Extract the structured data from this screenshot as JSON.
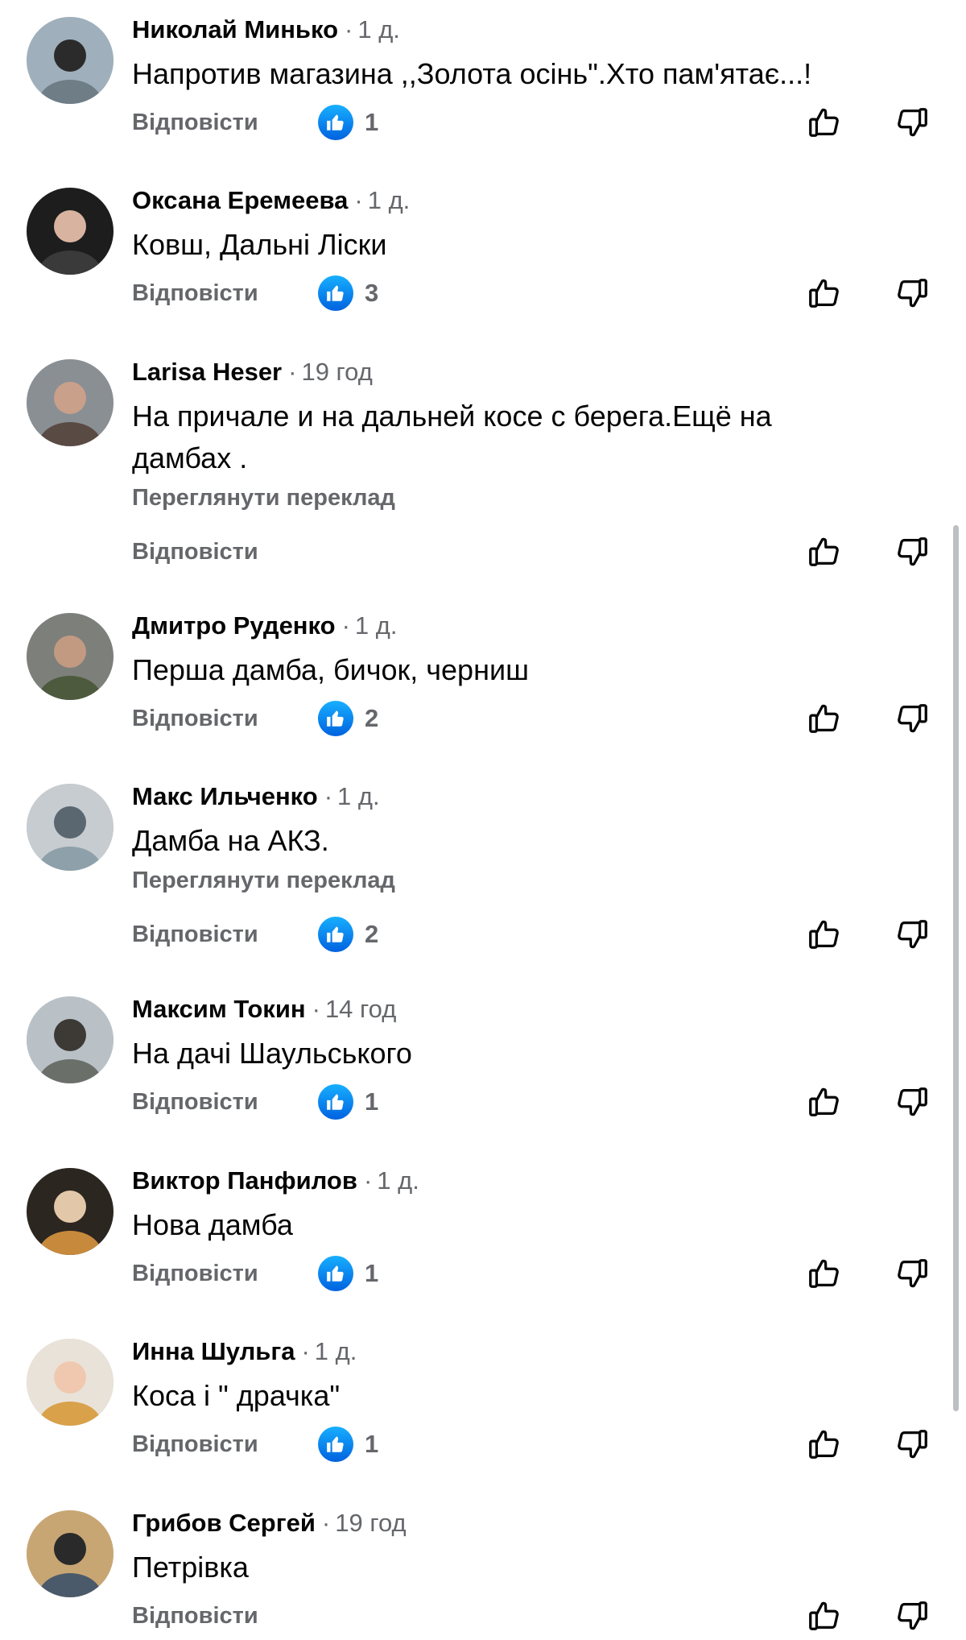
{
  "labels": {
    "reply": "Відповісти",
    "translate": "Переглянути переклад"
  },
  "icons": {
    "like": "like-icon",
    "upvote": "thumbs-up-outline-icon",
    "downvote": "thumbs-down-outline-icon"
  },
  "colors": {
    "like_blue": "#0866ff",
    "muted": "#65676b",
    "text": "#050505"
  },
  "comments": [
    {
      "author": "Николай Минько",
      "time": "1 д.",
      "text": "Напротив магазина ,,Золота осінь\".Хто пам'ятає...!",
      "likes": "1",
      "translate": false
    },
    {
      "author": "Оксана Еремеева",
      "time": "1 д.",
      "text": "Ковш, Дальні Ліски",
      "likes": "3",
      "translate": false
    },
    {
      "author": "Larisa Heser",
      "time": "19 год",
      "text": "На причале и на дальней косе с берега.Ещё на дамбах .",
      "likes": null,
      "translate": true
    },
    {
      "author": "Дмитро Руденко",
      "time": "1 д.",
      "text": "Перша дамба, бичок, черниш",
      "likes": "2",
      "translate": false
    },
    {
      "author": "Макс Ильченко",
      "time": "1 д.",
      "text": "Дамба на АКЗ.",
      "likes": "2",
      "translate": true
    },
    {
      "author": "Максим Токин",
      "time": "14 год",
      "text": "На дачі Шаульського",
      "likes": "1",
      "translate": false
    },
    {
      "author": "Виктор Панфилов",
      "time": "1 д.",
      "text": "Нова дамба",
      "likes": "1",
      "translate": false
    },
    {
      "author": "Инна Шульга",
      "time": "1 д.",
      "text": "Коса і \" драчка\"",
      "likes": "1",
      "translate": false
    },
    {
      "author": "Грибов Сергей",
      "time": "19 год",
      "text": "Петрівка",
      "likes": null,
      "translate": false
    }
  ]
}
